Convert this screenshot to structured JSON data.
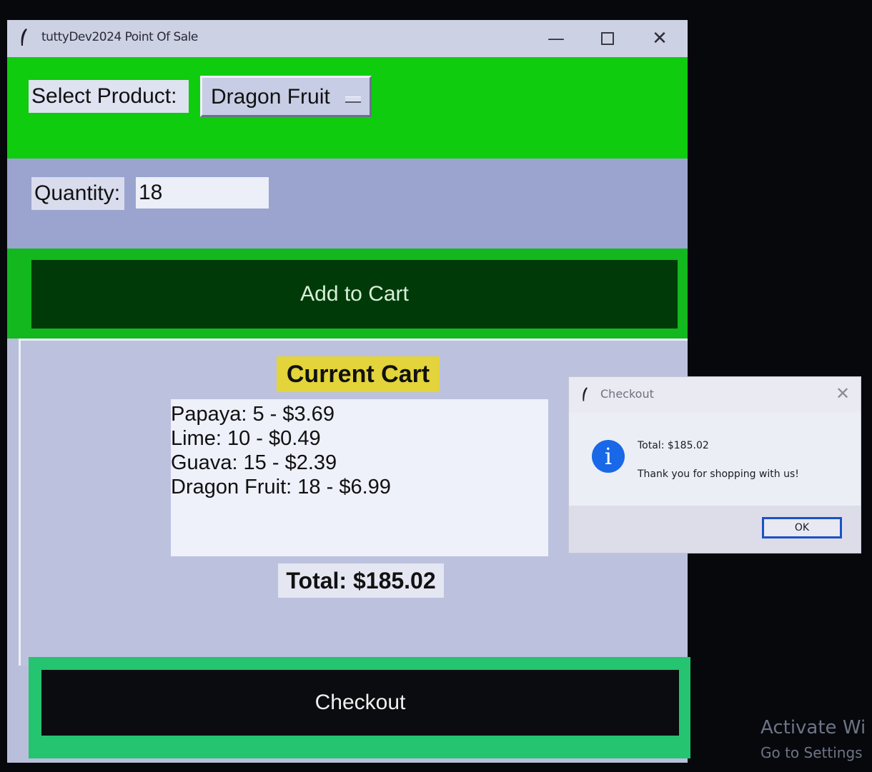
{
  "window": {
    "title": "tuttyDev2024 Point Of Sale",
    "minimize_glyph": "—",
    "close_glyph": "✕"
  },
  "product": {
    "label": "Select Product:",
    "selected": "Dragon Fruit"
  },
  "quantity": {
    "label": "Quantity:",
    "value": "18"
  },
  "add_to_cart": {
    "label": "Add to Cart"
  },
  "cart": {
    "title": "Current Cart",
    "items": [
      "Papaya: 5 - $3.69",
      "Lime: 10 - $0.49",
      "Guava: 15 - $2.39",
      "Dragon Fruit: 18 - $6.99"
    ],
    "total": "Total: $185.02"
  },
  "checkout": {
    "label": "Checkout"
  },
  "dialog": {
    "title": "Checkout",
    "icon_glyph": "i",
    "line1": "Total: $185.02",
    "line2": "Thank you for shopping with us!",
    "ok_label": "OK",
    "close_glyph": "✕"
  },
  "desktop": {
    "activate_line1": "Activate Wi",
    "activate_line2": "Go to Settings"
  },
  "colors": {
    "product_bar": "#0fcc0f",
    "quantity_bar": "#9aa4cf",
    "add_button": "#003a08",
    "cart_title_bg": "#e2d43a",
    "checkout_border": "#25c470",
    "checkout_button": "#0a0c10",
    "info_icon": "#1868e8"
  }
}
